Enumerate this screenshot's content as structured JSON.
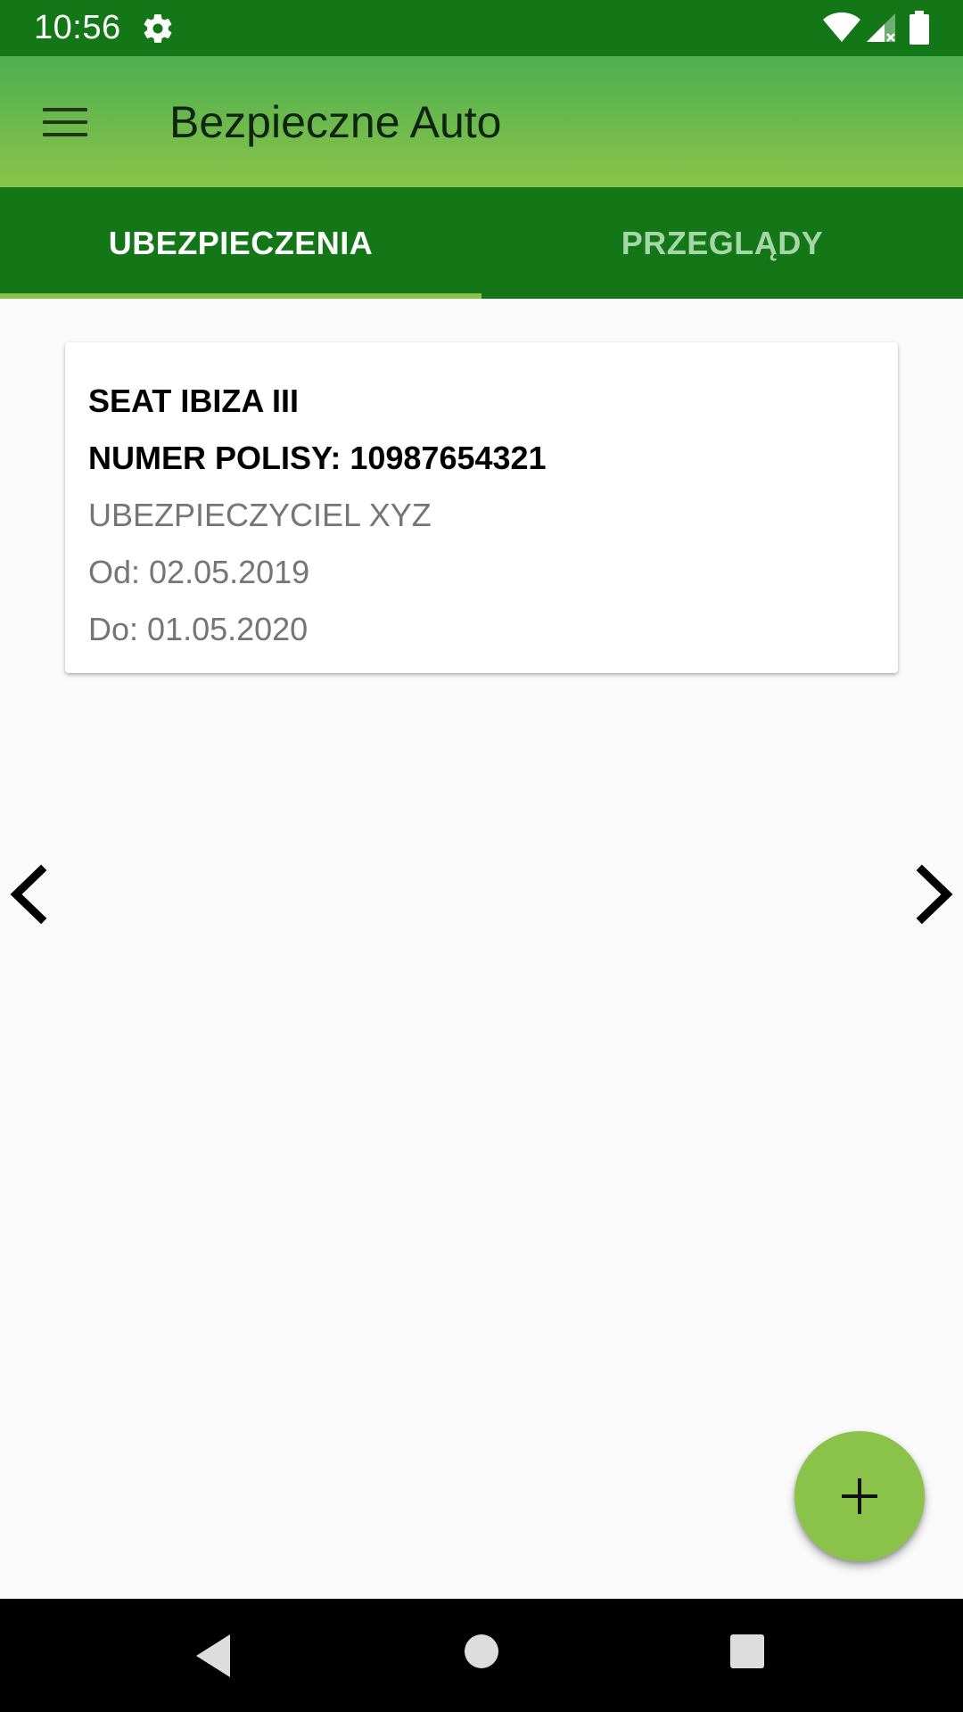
{
  "status_bar": {
    "time": "10:56",
    "icons": [
      "gear-icon",
      "wifi-icon",
      "signal-icon",
      "battery-icon"
    ]
  },
  "app_bar": {
    "title": "Bezpieczne Auto",
    "menu_icon": "hamburger-menu-icon"
  },
  "tabs": [
    {
      "label": "UBEZPIECZENIA",
      "selected": true
    },
    {
      "label": "PRZEGLĄDY",
      "selected": false
    }
  ],
  "card": {
    "car_name": "SEAT IBIZA III",
    "policy_number": "NUMER POLISY: 10987654321",
    "insurer": "UBEZPIECZYCIEL XYZ",
    "from": "Od: 02.05.2019",
    "to": "Do: 01.05.2020"
  },
  "navigation": {
    "prev_icon": "chevron-left-icon",
    "next_icon": "chevron-right-icon"
  },
  "fab": {
    "icon": "plus-icon"
  },
  "system_nav": {
    "icons": [
      "back-icon",
      "home-icon",
      "recents-icon"
    ]
  },
  "colors": {
    "status_bar": "#137617",
    "app_bar_top": "#4caf50",
    "app_bar_bottom": "#8bc34a",
    "tab_bar": "#137617",
    "tab_indicator": "#8bc34a",
    "fab": "#8bc34a",
    "background": "#fafafa"
  }
}
